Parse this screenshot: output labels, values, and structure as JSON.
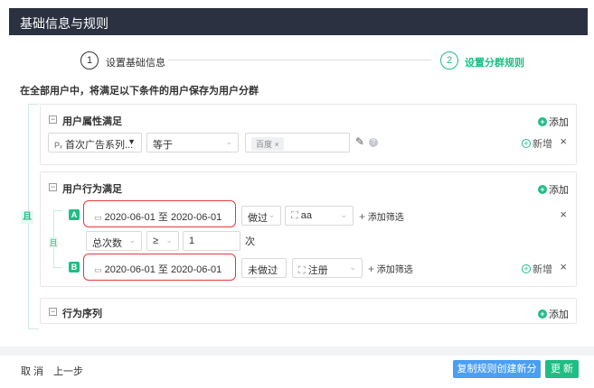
{
  "header": {
    "title": "基础信息与规则"
  },
  "steps": [
    {
      "num": "1",
      "label": "设置基础信息"
    },
    {
      "num": "2",
      "label": "设置分群规则"
    }
  ],
  "instruction": "在全部用户中，将满足以下条件的用户保存为用户分群",
  "outer_connector": "且",
  "add_label": "添加",
  "new_label": "新增",
  "attr_panel": {
    "title": "用户属性满足",
    "property": "首次广告系列...",
    "property_prefix": "Pₓ",
    "operator": "等于",
    "value_tag": "百度"
  },
  "behavior_panel": {
    "title": "用户行为满足",
    "inner_connector": "且",
    "rules": [
      {
        "badge": "A",
        "date_range": "2020-06-01 至 2020-06-01",
        "action": "做过",
        "event": "aa",
        "filter_label": "添加筛选"
      },
      {
        "badge": "B",
        "date_range": "2020-06-01 至 2020-06-01",
        "action": "未做过",
        "event": "注册",
        "filter_label": "添加筛选"
      }
    ],
    "sub_condition": {
      "metric": "总次数",
      "op": "≥",
      "value": "1",
      "unit": "次"
    }
  },
  "sequence_panel": {
    "title": "行为序列"
  },
  "footer": {
    "cancel": "取 消",
    "prev": "上一步",
    "copy_create": "复制规则创建新分群",
    "update": "更 新"
  },
  "colors": {
    "accent": "#1fbd84",
    "header_bg": "#2b3140",
    "blue": "#4a9ff5",
    "red_highlight": "#e23b3b"
  }
}
